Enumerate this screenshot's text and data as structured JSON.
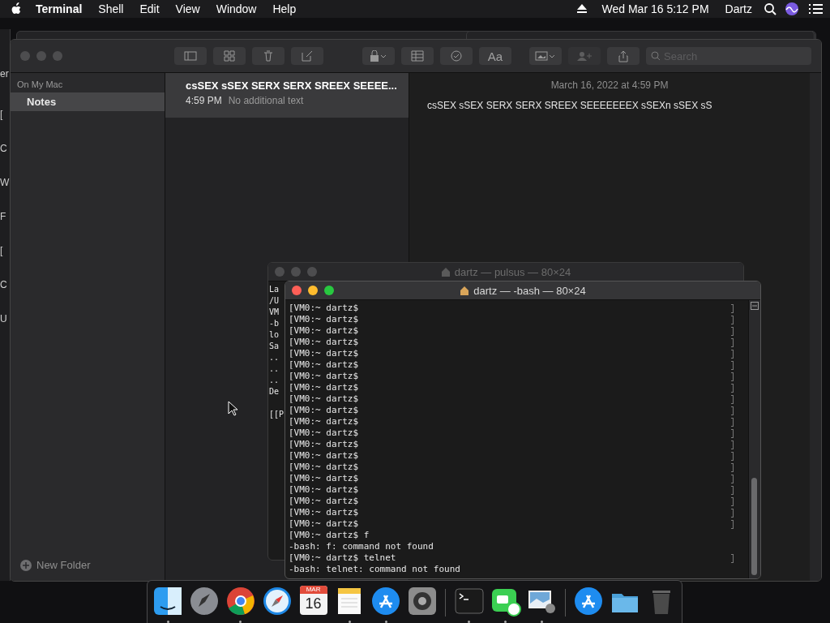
{
  "menubar": {
    "menus": [
      {
        "label": "Terminal",
        "kind": "app"
      },
      {
        "label": "Shell",
        "kind": "menu"
      },
      {
        "label": "Edit",
        "kind": "menu"
      },
      {
        "label": "View",
        "kind": "menu"
      },
      {
        "label": "Window",
        "kind": "menu"
      },
      {
        "label": "Help",
        "kind": "menu"
      }
    ],
    "clock": "Wed Mar 16  5:12 PM",
    "user": "Dartz"
  },
  "edge_window": {
    "letters": [
      "er",
      "[",
      "C",
      "W",
      "F",
      "[",
      "C",
      "U"
    ]
  },
  "notes_window": {
    "toolbar": {
      "font_button": "Aa",
      "collaborate_disabled": true,
      "search": {
        "placeholder": "Search"
      }
    },
    "sidebar": {
      "section": "On My Mac",
      "folders": [
        {
          "label": "Notes",
          "selected": true
        }
      ],
      "new_folder": "New Folder"
    },
    "notes": [
      {
        "title": "csSEX sSEX SERX SERX SREEX SEEEE...",
        "time": "4:59 PM",
        "preview": "No additional text",
        "selected": true
      }
    ],
    "note": {
      "date": "March 16, 2022 at 4:59 PM",
      "body": "csSEX sSEX SERX SERX SREEX SEEEEEEEX sSEXn sSEX sS"
    }
  },
  "terminals": [
    {
      "title": "dartz — pulsus — 80×24",
      "active": false,
      "lines": [
        "La",
        "/U",
        "VM",
        "-b",
        "lo",
        "Sa",
        "..",
        "..",
        "..",
        "De"
      ],
      "last_line": "[[P"
    },
    {
      "title": "dartz — -bash — 80×24",
      "active": true,
      "lines": [
        {
          "text": "[VM0:~ dartz$",
          "marked": true
        },
        {
          "text": "[VM0:~ dartz$",
          "marked": true
        },
        {
          "text": "[VM0:~ dartz$",
          "marked": true
        },
        {
          "text": "[VM0:~ dartz$",
          "marked": true
        },
        {
          "text": "[VM0:~ dartz$",
          "marked": true
        },
        {
          "text": "[VM0:~ dartz$",
          "marked": true
        },
        {
          "text": "[VM0:~ dartz$",
          "marked": true
        },
        {
          "text": "[VM0:~ dartz$",
          "marked": true
        },
        {
          "text": "[VM0:~ dartz$",
          "marked": true
        },
        {
          "text": "[VM0:~ dartz$",
          "marked": true
        },
        {
          "text": "[VM0:~ dartz$",
          "marked": true
        },
        {
          "text": "[VM0:~ dartz$",
          "marked": true
        },
        {
          "text": "[VM0:~ dartz$",
          "marked": true
        },
        {
          "text": "[VM0:~ dartz$",
          "marked": true
        },
        {
          "text": "[VM0:~ dartz$",
          "marked": true
        },
        {
          "text": "[VM0:~ dartz$",
          "marked": true
        },
        {
          "text": "[VM0:~ dartz$",
          "marked": true
        },
        {
          "text": "[VM0:~ dartz$",
          "marked": true
        },
        {
          "text": "[VM0:~ dartz$",
          "marked": true
        },
        {
          "text": "[VM0:~ dartz$",
          "marked": true
        },
        {
          "text": "[VM0:~ dartz$ f",
          "marked": false
        },
        {
          "text": "-bash: f: command not found",
          "marked": false
        },
        {
          "text": "[VM0:~ dartz$ telnet",
          "marked": true
        },
        {
          "text": "-bash: telnet: command not found",
          "marked": false
        }
      ]
    }
  ],
  "dock": {
    "apps": [
      {
        "kind": "finder",
        "running": true
      },
      {
        "kind": "launchpad",
        "running": false
      },
      {
        "kind": "chrome",
        "running": true
      },
      {
        "kind": "safari",
        "running": false
      },
      {
        "kind": "calendar",
        "running": false,
        "month": "MAR",
        "day": "16"
      },
      {
        "kind": "notes",
        "running": true
      },
      {
        "kind": "appstore",
        "running": true
      },
      {
        "kind": "settings",
        "running": false
      },
      {
        "kind": "separator"
      },
      {
        "kind": "terminal",
        "running": true
      },
      {
        "kind": "facetime",
        "running": true
      },
      {
        "kind": "preview",
        "running": true
      },
      {
        "kind": "separator"
      },
      {
        "kind": "downloads",
        "running": false
      },
      {
        "kind": "folder",
        "running": false
      },
      {
        "kind": "trash",
        "running": false
      }
    ]
  }
}
